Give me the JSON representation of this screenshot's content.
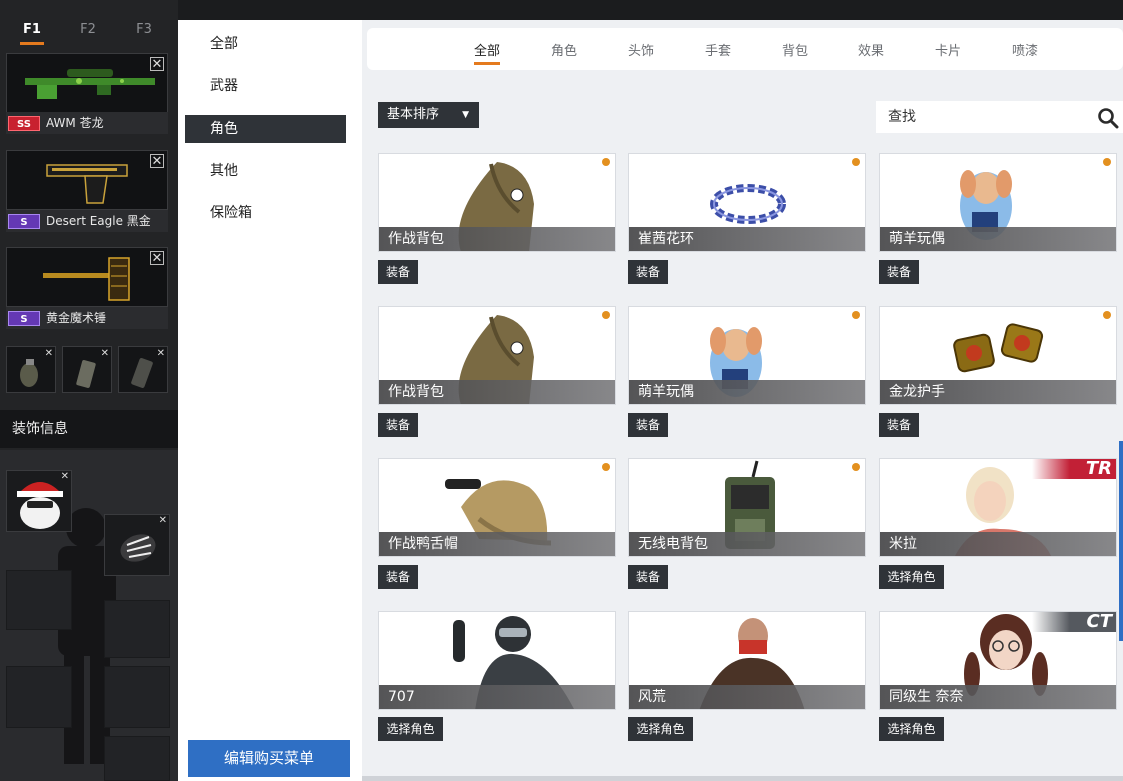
{
  "loadout_tabs": [
    "F1",
    "F2",
    "F3"
  ],
  "weapons": [
    {
      "name": "AWM 苍龙",
      "rank": "SS",
      "rank_color": "#c8212f"
    },
    {
      "name": "Desert Eagle 黑金",
      "rank": "S",
      "rank_color": "#6438b4"
    },
    {
      "name": "黄金魔术锤",
      "rank": "S",
      "rank_color": "#6438b4"
    }
  ],
  "decoration_header": "装饰信息",
  "categories": [
    "全部",
    "武器",
    "角色",
    "其他",
    "保险箱"
  ],
  "active_category": "角色",
  "edit_button": "编辑购买菜单",
  "type_tabs": [
    "全部",
    "角色",
    "头饰",
    "手套",
    "背包",
    "效果",
    "卡片",
    "喷漆"
  ],
  "active_type_tab": "全部",
  "sort_label": "基本排序",
  "search_placeholder": "查找",
  "accent_color": "#e47a1e",
  "items": [
    {
      "name": "作战背包",
      "action": "装备",
      "new": true
    },
    {
      "name": "崔茜花环",
      "action": "装备",
      "new": true
    },
    {
      "name": "萌羊玩偶",
      "action": "装备",
      "new": true
    },
    {
      "name": "作战背包",
      "action": "装备",
      "new": true
    },
    {
      "name": "萌羊玩偶",
      "action": "装备",
      "new": true
    },
    {
      "name": "金龙护手",
      "action": "装备",
      "new": true
    },
    {
      "name": "作战鸭舌帽",
      "action": "装备",
      "new": true
    },
    {
      "name": "无线电背包",
      "action": "装备",
      "new": true
    },
    {
      "name": "米拉",
      "action": "选择角色",
      "team": "TR"
    },
    {
      "name": "707",
      "action": "选择角色"
    },
    {
      "name": "风荒",
      "action": "选择角色"
    },
    {
      "name": "同级生 奈奈",
      "action": "选择角色",
      "team": "CT"
    }
  ]
}
